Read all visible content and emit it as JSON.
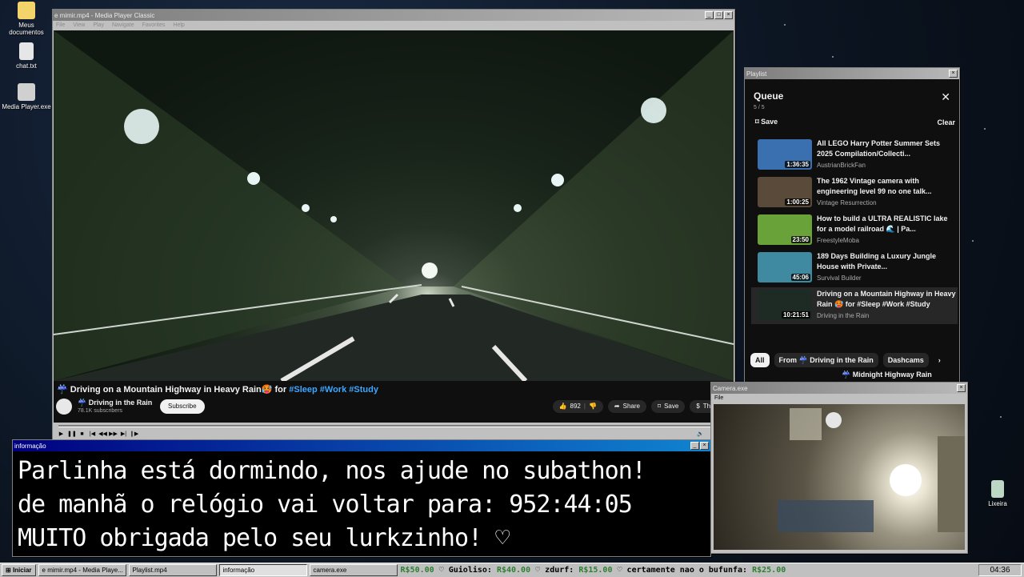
{
  "desktop": {
    "icons": [
      {
        "label": "Meus documentos",
        "icon": "folder-icon"
      },
      {
        "label": "chat.txt",
        "icon": "text-file-icon"
      },
      {
        "label": "Media Player.exe",
        "icon": "media-player-icon"
      }
    ],
    "recycle_bin": "Lixeira"
  },
  "media_player": {
    "title": "e mimir.mp4 - Media Player Classic",
    "menu": [
      "File",
      "View",
      "Play",
      "Navigate",
      "Favorites",
      "Help"
    ],
    "video": {
      "title_prefix": "Driving on a Mountain Highway in Heavy Rain",
      "title_for": "for",
      "tags": [
        "#Sleep",
        "#Work",
        "#Study"
      ],
      "channel": "Driving in the Rain",
      "subscribers": "78.1K subscribers",
      "subscribe": "Subscribe",
      "likes": "892",
      "share": "Share",
      "save": "Save",
      "thanks": "Thanks"
    }
  },
  "playlist": {
    "window_title": "Playlist",
    "heading": "Queue",
    "count": "5 / 5",
    "save": "Save",
    "clear": "Clear",
    "items": [
      {
        "title": "All LEGO Harry Potter Summer Sets 2025 Compilation/Collecti...",
        "channel": "AustrianBrickFan",
        "duration": "1:36:35",
        "color": "#3a6fb0"
      },
      {
        "title": "The 1962 Vintage camera with engineering level 99 no one talk...",
        "channel": "Vintage Resurrection",
        "duration": "1:00:25",
        "color": "#5a4a3a"
      },
      {
        "title": "How to build a ULTRA REALISTIC lake for a model railroad 🌊 | Pa...",
        "channel": "FreestyleMoba",
        "duration": "23:50",
        "color": "#6aa23a"
      },
      {
        "title": "189 Days Building a Luxury Jungle House with Private...",
        "channel": "Survival Builder",
        "duration": "45:06",
        "color": "#3f8aa0"
      },
      {
        "title": "Driving on a Mountain Highway in Heavy Rain 🥵 for #Sleep #Work #Study",
        "channel": "Driving in the Rain",
        "duration": "10:21:51",
        "color": "#1e2a24"
      }
    ],
    "chips": [
      "All",
      "From ☔ Driving in the Rain",
      "Dashcams"
    ],
    "next_title": "☔ Midnight Highway Rain"
  },
  "info": {
    "title": "informação",
    "lines": [
      "Parlinha está dormindo, nos ajude no subathon!",
      "de manhã o relógio vai voltar para:  952:44:05",
      "MUITO obrigada pelo seu lurkzinho! ♡"
    ]
  },
  "camera": {
    "title": "Camera.exe",
    "menu": "File"
  },
  "taskbar": {
    "start": "Iniciar",
    "tasks": [
      "e mimir.mp4 - Media Playe...",
      "Playlist.mp4",
      "informação",
      "camera.exe"
    ],
    "ticker": [
      {
        "name": "",
        "amount": "R$50.00"
      },
      {
        "name": "Guioliso:",
        "amount": "R$40.00"
      },
      {
        "name": "zdurf:",
        "amount": "R$15.00"
      },
      {
        "name": "certamente nao o bufunfa:",
        "amount": "R$25.00"
      }
    ],
    "clock": "04:36"
  }
}
